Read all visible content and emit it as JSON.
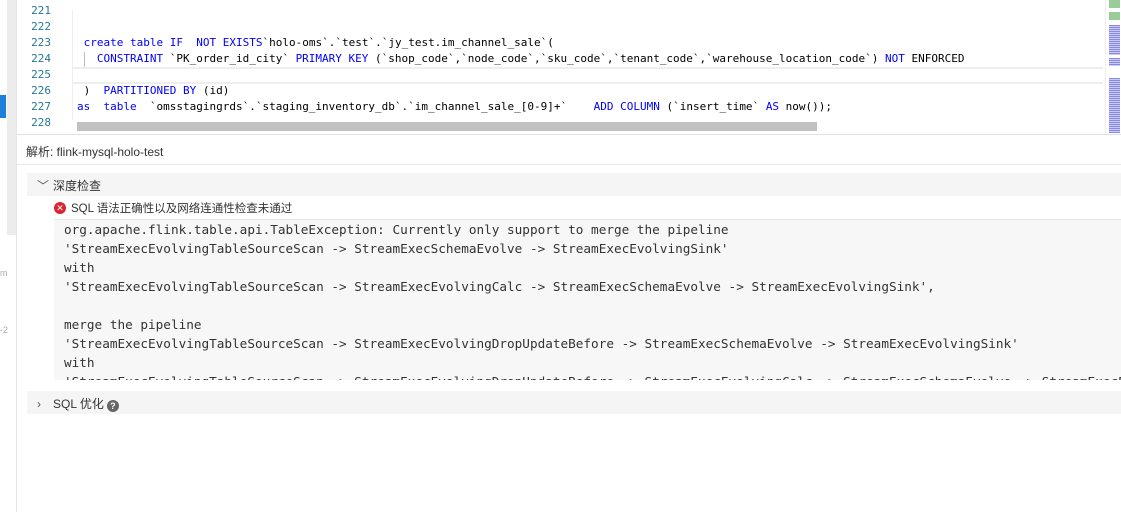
{
  "editor": {
    "lines": [
      {
        "num": "221",
        "code": ""
      },
      {
        "num": "222",
        "code": ""
      },
      {
        "num": "223",
        "code": " create table IF  NOT EXISTS`holo-oms`.`test`.`jy_test.im_channel_sale`("
      },
      {
        "num": "224",
        "code": "   CONSTRAINT `PK_order_id_city` PRIMARY KEY (`shop_code`,`node_code`,`sku_code`,`tenant_code`,`warehouse_location_code`) NOT ENFORCED"
      },
      {
        "num": "225",
        "code": ""
      },
      {
        "num": "226",
        "code": " )  PARTITIONED BY (id)"
      },
      {
        "num": "227",
        "code": "as  table  `omsstagingrds`.`staging_inventory_db`.`im_channel_sale_[0-9]+`    ADD COLUMN (`insert_time` AS now());"
      },
      {
        "num": "228",
        "code": ""
      }
    ]
  },
  "panel": {
    "title": "解析: flink-mysql-holo-test",
    "deep_check": {
      "label": "深度检查",
      "expanded": true,
      "status_icon": "error-circle-icon",
      "status_color": "#d9262c",
      "message": "SQL 语法正确性以及网络连通性检查未通过",
      "details": "org.apache.flink.table.api.TableException: Currently only support to merge the pipeline\n'StreamExecEvolvingTableSourceScan -> StreamExecSchemaEvolve -> StreamExecEvolvingSink'\nwith\n'StreamExecEvolvingTableSourceScan -> StreamExecEvolvingCalc -> StreamExecSchemaEvolve -> StreamExecEvolvingSink',\n\nmerge the pipeline\n'StreamExecEvolvingTableSourceScan -> StreamExecEvolvingDropUpdateBefore -> StreamExecSchemaEvolve -> StreamExecEvolvingSink'\nwith\n'StreamExecEvolvingTableSourceScan -> StreamExecEvolvingDropUpdateBefore -> StreamExecEvolvingCalc -> StreamExecSchemaEvolve -> StreamExecEvolvingSink'"
    },
    "sql_optimize": {
      "label": "SQL 优化",
      "expanded": false,
      "help_icon": "question-circle-icon"
    }
  },
  "left_fragments": [
    "m",
    "-2"
  ]
}
